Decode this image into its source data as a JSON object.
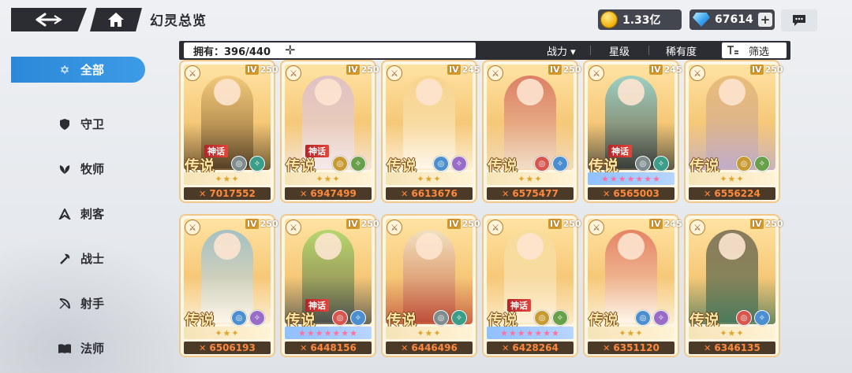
{
  "header": {
    "title": "幻灵总览",
    "gold": "1.33亿",
    "gems": "67614"
  },
  "filterbar": {
    "owned_label": "拥有：396/440",
    "sort_power": "战力 ▾",
    "sort_star": "星级",
    "sort_rarity": "稀有度",
    "filter_label": "筛选"
  },
  "sidebar": {
    "items": [
      {
        "label": "全部",
        "icon": "all-star-icon"
      },
      {
        "label": "守卫",
        "icon": "shield-icon"
      },
      {
        "label": "牧师",
        "icon": "priest-leaf-icon"
      },
      {
        "label": "刺客",
        "icon": "assassin-icon"
      },
      {
        "label": "战士",
        "icon": "axe-icon"
      },
      {
        "label": "射手",
        "icon": "bow-icon"
      },
      {
        "label": "法师",
        "icon": "book-icon"
      }
    ]
  },
  "cards": [
    {
      "level": "250",
      "power": "7017552",
      "rarity": "传说",
      "myth": "神话",
      "stars": "gold",
      "colors": [
        "#e9b860",
        "#3a2a1a"
      ]
    },
    {
      "level": "250",
      "power": "6947499",
      "rarity": "传说",
      "myth": "神话",
      "stars": "gold",
      "colors": [
        "#c7a9e6",
        "#f4f0ff"
      ]
    },
    {
      "level": "245",
      "power": "6613676",
      "rarity": "传说",
      "myth": "",
      "stars": "gold",
      "colors": [
        "#f3cf84",
        "#ffffff"
      ]
    },
    {
      "level": "250",
      "power": "6575477",
      "rarity": "传说",
      "myth": "",
      "stars": "gold",
      "colors": [
        "#c2333a",
        "#f0e2d6"
      ]
    },
    {
      "level": "245",
      "power": "6565003",
      "rarity": "传说",
      "myth": "神话",
      "stars": "pink",
      "colors": [
        "#4ec3e6",
        "#1a2630"
      ]
    },
    {
      "level": "250",
      "power": "6556224",
      "rarity": "传说",
      "myth": "",
      "stars": "gold",
      "colors": [
        "#d9a25a",
        "#b7a8d9"
      ]
    },
    {
      "level": "250",
      "power": "6506193",
      "rarity": "传说",
      "myth": "",
      "stars": "gold",
      "colors": [
        "#5aa9e6",
        "#ffffff"
      ]
    },
    {
      "level": "250",
      "power": "6448156",
      "rarity": "传说",
      "myth": "神话",
      "stars": "pink",
      "colors": [
        "#7fd14a",
        "#2f3c46"
      ]
    },
    {
      "level": "250",
      "power": "6446496",
      "rarity": "传说",
      "myth": "",
      "stars": "gold",
      "colors": [
        "#e8e2dc",
        "#b6392f"
      ]
    },
    {
      "level": "250",
      "power": "6428264",
      "rarity": "传说",
      "myth": "神话",
      "stars": "pink",
      "colors": [
        "#f2dc9a",
        "#fff7ea"
      ]
    },
    {
      "level": "245",
      "power": "6351120",
      "rarity": "传说",
      "myth": "",
      "stars": "gold",
      "colors": [
        "#d13a3a",
        "#ffffff"
      ]
    },
    {
      "level": "250",
      "power": "6346135",
      "rarity": "传说",
      "myth": "",
      "stars": "gold",
      "colors": [
        "#2a2a2a",
        "#2f6d58"
      ]
    }
  ],
  "colors": {
    "accent": "#2c88d9",
    "dark": "#2b2d33",
    "power": "#ff8a3d",
    "card_border": "#f0c98a"
  }
}
